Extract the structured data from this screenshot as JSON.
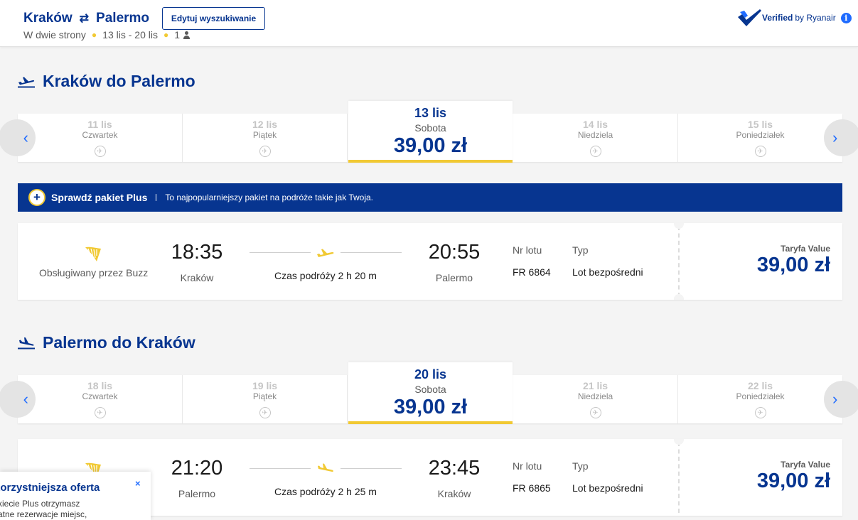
{
  "header": {
    "origin": "Kraków",
    "destination": "Palermo",
    "swap_icon": "⇄",
    "trip_type": "W dwie strony",
    "dates": "13 lis - 20 lis",
    "passengers": "1",
    "edit_button": "Edytuj wyszukiwanie",
    "verified_bold": "Verified",
    "verified_text": "by Ryanair",
    "info_icon": "i"
  },
  "outbound": {
    "title": "Kraków do Palermo",
    "days": [
      {
        "date": "11 lis",
        "name": "Czwartek"
      },
      {
        "date": "12 lis",
        "name": "Piątek"
      },
      {
        "date": "13 lis",
        "name": "Sobota",
        "price": "39,00 zł"
      },
      {
        "date": "14 lis",
        "name": "Niedziela"
      },
      {
        "date": "15 lis",
        "name": "Poniedziałek"
      }
    ],
    "flight": {
      "operated_by": "Obsługiwany przez Buzz",
      "dep_time": "18:35",
      "dep_city": "Kraków",
      "duration": "Czas podróży 2 h 20 m",
      "arr_time": "20:55",
      "arr_city": "Palermo",
      "flight_no_label": "Nr lotu",
      "flight_no": "FR 6864",
      "type_label": "Typ",
      "type": "Lot bezpośredni",
      "fare_name": "Taryfa Value",
      "fare_price": "39,00 zł"
    }
  },
  "plus_banner": {
    "icon": "+",
    "title": "Sprawdź pakiet Plus",
    "text": "To najpopularniejszy pakiet na podróże takie jak Twoja."
  },
  "inbound": {
    "title": "Palermo do Kraków",
    "days": [
      {
        "date": "18 lis",
        "name": "Czwartek"
      },
      {
        "date": "19 lis",
        "name": "Piątek"
      },
      {
        "date": "20 lis",
        "name": "Sobota",
        "price": "39,00 zł"
      },
      {
        "date": "21 lis",
        "name": "Niedziela"
      },
      {
        "date": "22 lis",
        "name": "Poniedziałek"
      }
    ],
    "flight": {
      "dep_time": "21:20",
      "dep_city": "Palermo",
      "duration": "Czas podróży 2 h 25 m",
      "arr_time": "23:45",
      "arr_city": "Kraków",
      "flight_no_label": "Nr lotu",
      "flight_no": "FR 6865",
      "type_label": "Typ",
      "type": "Lot bezpośredni",
      "fare_name": "Taryfa Value",
      "fare_price": "39,00 zł"
    }
  },
  "popup": {
    "title": "korzystniejsza oferta",
    "line1": "kiecie Plus otrzymasz",
    "line2": "atne rezerwacje miejsc,",
    "close": "×"
  },
  "colors": {
    "brand_blue": "#073590",
    "accent_yellow": "#f1c933",
    "link_blue": "#1f6bff"
  }
}
